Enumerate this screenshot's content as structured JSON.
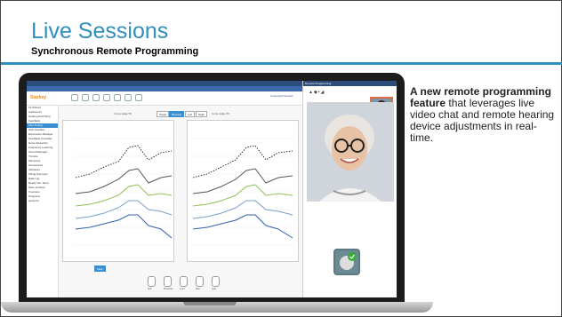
{
  "slide": {
    "title": "Live Sessions",
    "subtitle": "Synchronous Remote Programming",
    "desc_bold": "A new remote programming feature",
    "desc_rest": "that leverages live video chat and remote hearing device adjustments in real-time."
  },
  "app": {
    "brand": "Starkey",
    "sidebar_items": [
      "Fit Wizard",
      "Audiometry",
      "Hearing Aid Fitting",
      "Feedback",
      "Fine Tuning",
      "Gain Handles",
      "Expression Manager",
      "Feedback Canceller",
      "Noise Reduction",
      "Frequency Lowering",
      "Sound Manager",
      "Tinnitus",
      "Memories",
      "Accessories",
      "Indicators",
      "Fitting Summary",
      "Data Log",
      "Ready Set. Save.",
      "Save and Exit",
      "Overview",
      "Programs",
      "Quick Fit"
    ],
    "active_sidebar_index": 4,
    "left_chart_label": "Curve Edge 55",
    "right_chart_label": "Curve Edge 55",
    "buttons": {
      "single": "Single",
      "binaural": "Binaural",
      "left": "Left",
      "right": "Right",
      "mute": "Mute"
    },
    "bottom_knob_labels": [
      "Soft",
      "Moderate",
      "Loud",
      "Max",
      "Gain"
    ],
    "video_title": "Remote Programming",
    "connection_status": "Connected Session",
    "colors": {
      "accent": "#2f8fbf",
      "brand": "#f08a1c",
      "app_header": "#2c4c7c"
    }
  }
}
